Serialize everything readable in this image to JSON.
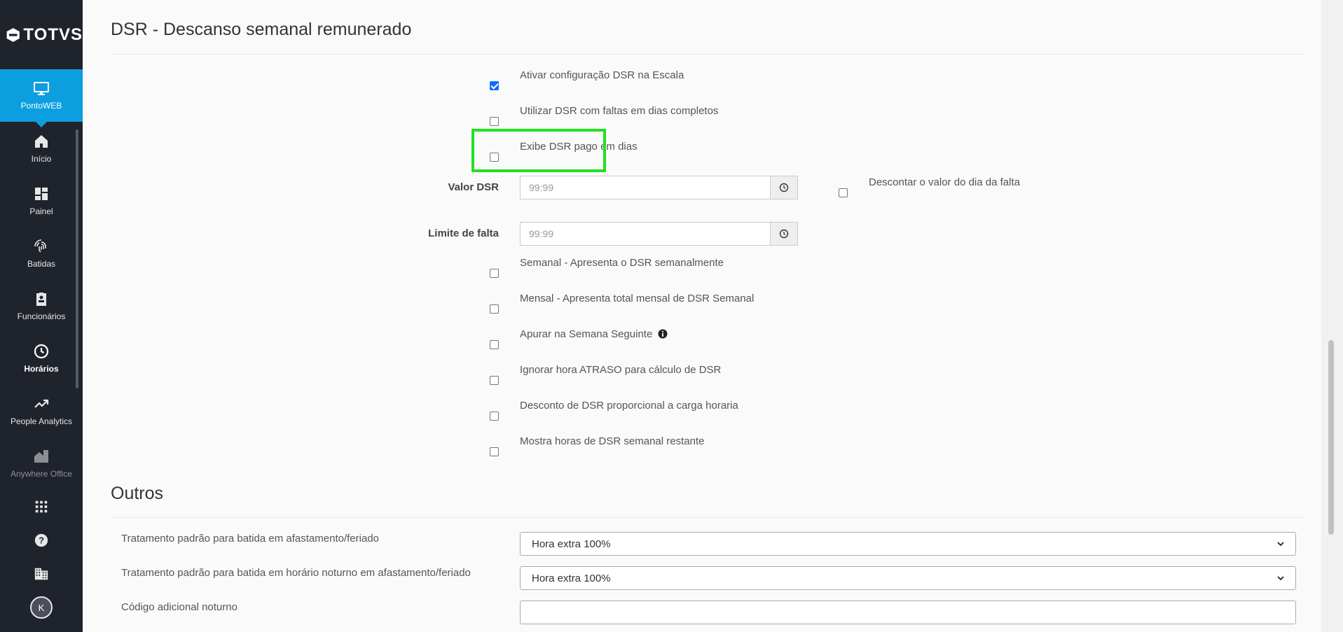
{
  "sidebar": {
    "logo_text": "TOTVS",
    "app": {
      "label": "PontoWEB",
      "icon": "monitor-icon"
    },
    "items": [
      {
        "label": "Início",
        "icon": "home-icon",
        "active": false
      },
      {
        "label": "Painel",
        "icon": "dashboard-icon",
        "active": false
      },
      {
        "label": "Batidas",
        "icon": "fingerprint-icon",
        "active": false
      },
      {
        "label": "Funcionários",
        "icon": "badge-icon",
        "active": false
      },
      {
        "label": "Horários",
        "icon": "clock-icon",
        "active": true
      },
      {
        "label": "People Analytics",
        "icon": "trending-up-icon",
        "active": false
      },
      {
        "label": "Anywhere Office",
        "icon": "home-work-icon",
        "active": false
      }
    ],
    "bottom": [
      "apps-grid-icon",
      "help-icon",
      "company-icon"
    ],
    "avatar_initial": "K"
  },
  "dsr": {
    "title": "DSR - Descanso semanal remunerado",
    "options_top": [
      {
        "label": "Ativar configuração DSR na Escala",
        "checked": true
      },
      {
        "label": "Utilizar DSR com faltas em dias completos",
        "checked": false
      },
      {
        "label": "Exibe DSR pago em dias",
        "checked": false
      }
    ],
    "valor_dsr": {
      "label": "Valor DSR",
      "placeholder": "99:99"
    },
    "descontar": {
      "label": "Descontar o valor do dia da falta",
      "checked": false
    },
    "limite_falta": {
      "label": "Limite de falta",
      "placeholder": "99:99"
    },
    "options_bottom": [
      {
        "label": "Semanal - Apresenta o DSR semanalmente",
        "checked": false
      },
      {
        "label": "Mensal - Apresenta total mensal de DSR Semanal",
        "checked": false
      },
      {
        "label": "Apurar na Semana Seguinte",
        "checked": false,
        "info": true
      },
      {
        "label": "Ignorar hora ATRASO para cálculo de DSR",
        "checked": false
      },
      {
        "label": "Desconto de DSR proporcional a carga horaria",
        "checked": false
      },
      {
        "label": "Mostra horas de DSR semanal restante",
        "checked": false
      }
    ]
  },
  "outros": {
    "title": "Outros",
    "rows": [
      {
        "label": "Tratamento padrão para batida em afastamento/feriado",
        "value": "Hora extra 100%"
      },
      {
        "label": "Tratamento padrão para batida em horário noturno em afastamento/feriado",
        "value": "Hora extra 100%"
      },
      {
        "label": "Código adicional noturno",
        "value": ""
      }
    ]
  }
}
